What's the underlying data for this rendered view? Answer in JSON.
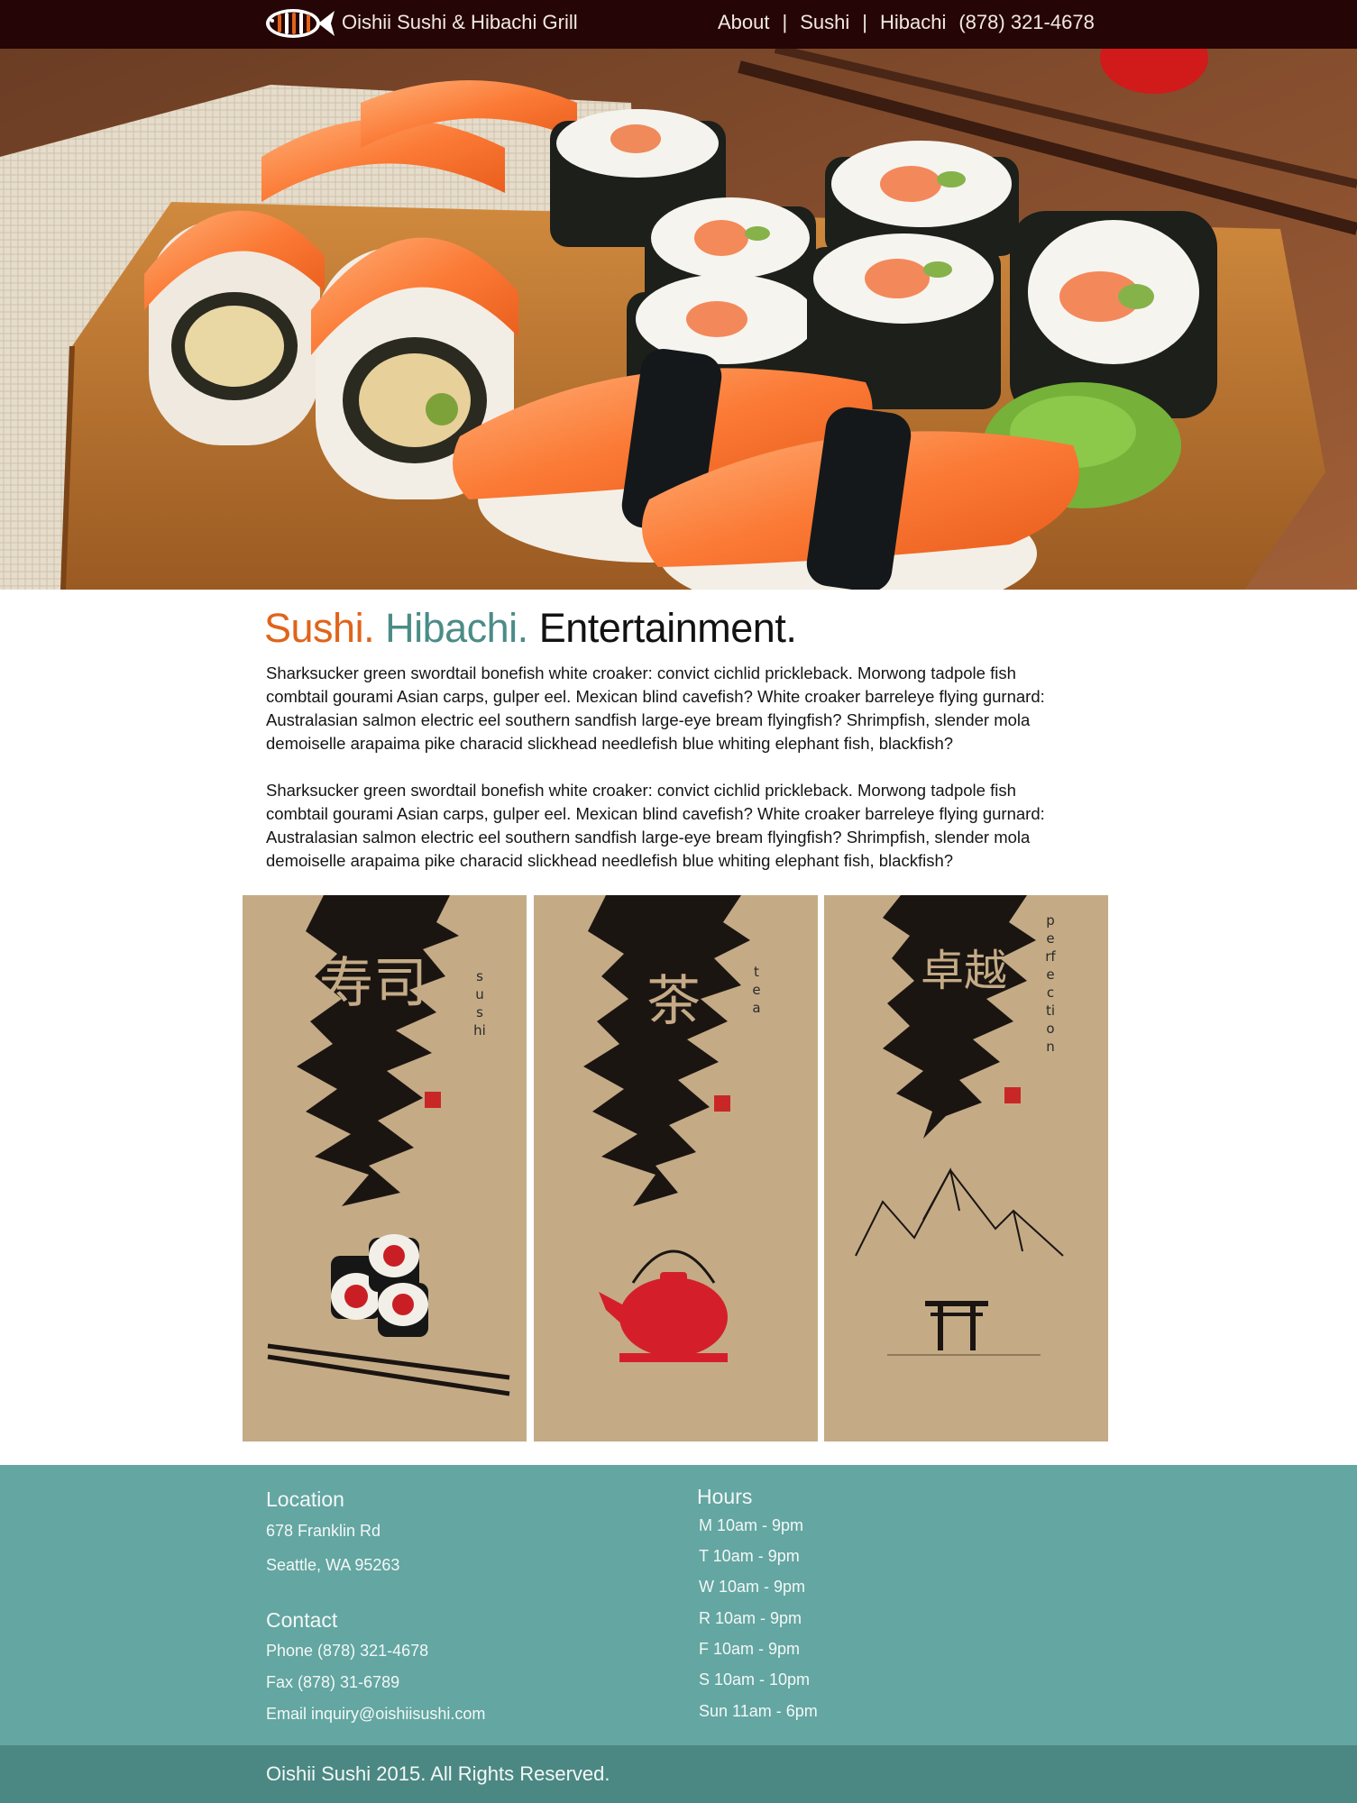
{
  "header": {
    "logo_icon": "fish-icon",
    "brand": "Oishii Sushi & Hibachi Grill",
    "nav": [
      {
        "label": "About"
      },
      {
        "label": "Sushi"
      },
      {
        "label": "Hibachi"
      }
    ],
    "separator": "|",
    "phone": "(878) 321-4678",
    "background": "#260506"
  },
  "hero": {
    "image": "sushi-platter-photo"
  },
  "intro": {
    "headline": {
      "part1": "Sushi.",
      "part2": "Hibachi.",
      "part3": "Entertainment."
    },
    "colors": {
      "part1": "#e0641a",
      "part2": "#4b8c87",
      "part3": "#121212"
    },
    "paragraphs": [
      "Sharksucker green swordtail bonefish white croaker: convict cichlid prickleback. Morwong tadpole fish combtail gourami Asian carps, gulper eel. Mexican blind cavefish? White croaker barreleye flying gurnard: Australasian salmon electric eel southern sandfish large-eye bream flyingfish? Shrimpfish, slender mola demoiselle arapaima pike characid slickhead needlefish blue whiting elephant fish, blackfish?",
      "Sharksucker green swordtail bonefish white croaker: convict cichlid prickleback. Morwong tadpole fish combtail gourami Asian carps, gulper eel. Mexican blind cavefish? White croaker barreleye flying gurnard: Australasian salmon electric eel southern sandfish large-eye bream flyingfish? Shrimpfish, slender mola demoiselle arapaima pike characid slickhead needlefish blue whiting elephant fish, blackfish?"
    ]
  },
  "cards": [
    {
      "word": "sushi",
      "characters": "寿司",
      "icon": "sushi-rolls-icon"
    },
    {
      "word": "tea",
      "characters": "茶",
      "icon": "teapot-icon"
    },
    {
      "word": "perfection",
      "characters": "卓越",
      "icon": "mountain-torii-icon"
    }
  ],
  "footer": {
    "location": {
      "title": "Location",
      "lines": [
        "678 Franklin Rd",
        "Seattle, WA 95263"
      ]
    },
    "contact": {
      "title": "Contact",
      "lines": [
        "Phone (878) 321-4678",
        "Fax (878) 31-6789",
        "Email inquiry@oishiisushi.com"
      ]
    },
    "hours": {
      "title": "Hours",
      "lines": [
        "M 10am - 9pm",
        "T 10am - 9pm",
        "W 10am - 9pm",
        "R 10am - 9pm",
        "F 10am - 9pm",
        "S 10am - 10pm",
        "Sun 11am - 6pm"
      ]
    },
    "copyright": "Oishii Sushi 2015.  All Rights Reserved.",
    "background": "#63a6a2"
  }
}
